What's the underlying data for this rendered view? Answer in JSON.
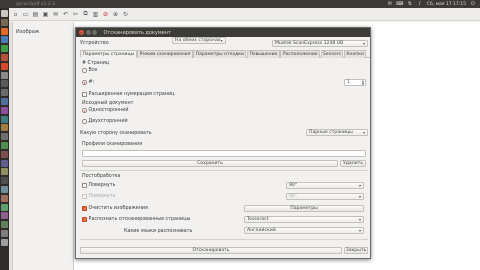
{
  "topbar": {
    "window_title": "gscan2pdf v1.2.3",
    "clock": "Сб, мая 17 17:15"
  },
  "app": {
    "left_label": "Изображ"
  },
  "dialog": {
    "title": "Отсканировать документ",
    "device_label": "Устройство",
    "device_value": "Mustek ScanExpress 1248 UB",
    "tabs": [
      {
        "label": "Параметры страницы"
      },
      {
        "label": "Режим сканирования"
      },
      {
        "label": "Параметры отладки"
      },
      {
        "label": "Повышение"
      },
      {
        "label": "Расположение"
      },
      {
        "label": "Sensors"
      },
      {
        "label": "Кнопки"
      }
    ],
    "pages": {
      "group": "# Страниц",
      "all": "Все",
      "n": "#:",
      "n_value": "1",
      "extended": "Расширенная нумерация страниц"
    },
    "source": {
      "group": "Исходный документ",
      "single": "Односторонний",
      "double": "Двухсторонний"
    },
    "side": {
      "label": "Какую сторону сканировать",
      "value": "Парные страницы"
    },
    "profiles": {
      "label": "Профили сканирования",
      "save": "Сохранить",
      "delete": "Удалить"
    },
    "post": {
      "group": "Постобработка",
      "rotate": "Повернуть",
      "rotate_side": "На обеих сторонах",
      "rotate_angle": "90°",
      "rotate2": "Повернуть",
      "rotate2_angle": "90°",
      "clean": "Очистить изображения",
      "params": "Параметры",
      "ocr": "Распознать отсканированные страницы",
      "ocr_engine": "Tesseract",
      "lang_label": "Какие языки распознавать",
      "lang_value": "Английский"
    },
    "scan_button": "Отсканировать",
    "close_button": "Закрыть"
  },
  "colors": {
    "accent": "#e05a2a",
    "panel": "#3c3b37"
  }
}
